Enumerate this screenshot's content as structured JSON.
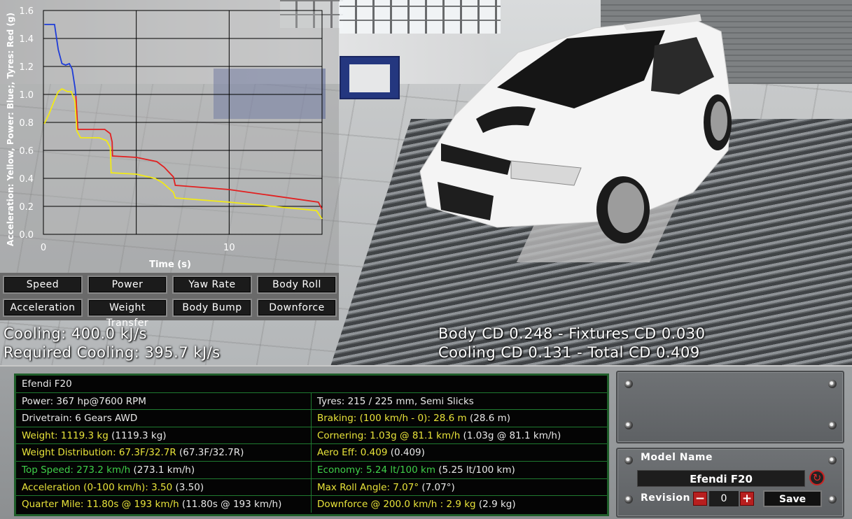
{
  "chart_data": {
    "type": "line",
    "title": "",
    "xlabel": "Time (s)",
    "ylabel": "Acceleration: Yellow, Power: Blue;, Tyres: Red (g)",
    "xlim": [
      0,
      15
    ],
    "ylim": [
      0,
      1.6
    ],
    "x_ticks": [
      "0",
      "10"
    ],
    "y_ticks": [
      "0.0",
      "0.2",
      "0.4",
      "0.6",
      "0.8",
      "1.0",
      "1.2",
      "1.4",
      "1.6"
    ],
    "series": [
      {
        "name": "Power",
        "color": "#1e3cd8",
        "x": [
          0.05,
          0.6,
          0.8,
          1.0,
          1.2,
          1.4,
          1.55,
          1.7,
          1.75
        ],
        "y": [
          1.5,
          1.5,
          1.32,
          1.22,
          1.21,
          1.22,
          1.18,
          1.05,
          0.99
        ]
      },
      {
        "name": "Tyres",
        "color": "#e22020",
        "x": [
          1.75,
          1.85,
          3.3,
          3.6,
          3.7,
          3.72,
          5.0,
          6.1,
          6.5,
          7.0,
          7.1,
          10.0,
          14.8,
          15.0
        ],
        "y": [
          0.99,
          0.75,
          0.75,
          0.72,
          0.66,
          0.56,
          0.55,
          0.52,
          0.48,
          0.41,
          0.35,
          0.32,
          0.23,
          0.18
        ]
      },
      {
        "name": "Acceleration",
        "color": "#f2ea16",
        "x": [
          0.05,
          0.3,
          0.6,
          0.8,
          1.0,
          1.3,
          1.5,
          1.7,
          1.8,
          2.0,
          3.0,
          3.4,
          3.6,
          3.65,
          5.0,
          6.0,
          6.4,
          7.0,
          7.1,
          10.0,
          14.7,
          14.9,
          15.0
        ],
        "y": [
          0.79,
          0.86,
          0.96,
          1.02,
          1.04,
          1.02,
          1.02,
          0.95,
          0.74,
          0.69,
          0.69,
          0.67,
          0.62,
          0.44,
          0.43,
          0.4,
          0.37,
          0.3,
          0.26,
          0.23,
          0.17,
          0.13,
          0.11
        ]
      }
    ]
  },
  "tabs": [
    "Speed",
    "Power",
    "Yaw Rate",
    "Body Roll",
    "Acceleration",
    "Weight Transfer",
    "Body Bump",
    "Downforce"
  ],
  "overlay": {
    "cooling": "Cooling: 400.0 kJ/s",
    "required_cooling": "Required Cooling: 395.7 kJ/s",
    "drag_line1": "Body CD 0.248 - Fixtures CD 0.030",
    "drag_line2": "Cooling CD 0.131 - Total CD 0.409"
  },
  "stats": {
    "car_name": "Efendi F20",
    "rows": [
      {
        "left": "Power: 367 hp@7600 RPM",
        "left_color": "w",
        "left_extra": "",
        "right": "Tyres: 215 / 225 mm, Semi Slicks",
        "right_color": "w",
        "right_extra": ""
      },
      {
        "left": "Drivetrain: 6 Gears AWD",
        "left_color": "w",
        "left_extra": "",
        "right": "Braking: (100 km/h - 0): 28.6 m",
        "right_color": "y",
        "right_extra": " (28.6 m)"
      },
      {
        "left": "Weight: 1119.3 kg",
        "left_color": "y",
        "left_extra": " (1119.3 kg)",
        "right": "Cornering: 1.03g @ 81.1 km/h",
        "right_color": "y",
        "right_extra": " (1.03g @ 81.1 km/h)"
      },
      {
        "left": "Weight Distribution: 67.3F/32.7R",
        "left_color": "y",
        "left_extra": " (67.3F/32.7R)",
        "right": "Aero Eff: 0.409",
        "right_color": "y",
        "right_extra": " (0.409)"
      },
      {
        "left": "Top Speed: 273.2 km/h",
        "left_color": "g",
        "left_extra": " (273.1 km/h)",
        "right": "Economy: 5.24 lt/100 km",
        "right_color": "g",
        "right_extra": " (5.25 lt/100 km)"
      },
      {
        "left": "Acceleration (0-100 km/h): 3.50",
        "left_color": "y",
        "left_extra": " (3.50)",
        "right": "Max Roll Angle: 7.07°",
        "right_color": "y",
        "right_extra": " (7.07°)"
      },
      {
        "left": "Quarter Mile: 11.80s @ 193 km/h",
        "left_color": "y",
        "left_extra": " (11.80s @ 193 km/h)",
        "right": "Downforce @ 200.0 km/h : 2.9 kg",
        "right_color": "y",
        "right_extra": " (2.9 kg)"
      }
    ]
  },
  "model": {
    "name_label": "Model Name",
    "name_value": "Efendi F20",
    "revision_label": "Revision",
    "revision_value": "0",
    "minus": "−",
    "plus": "+",
    "save_label": "Save",
    "refresh_icon": "↻"
  }
}
